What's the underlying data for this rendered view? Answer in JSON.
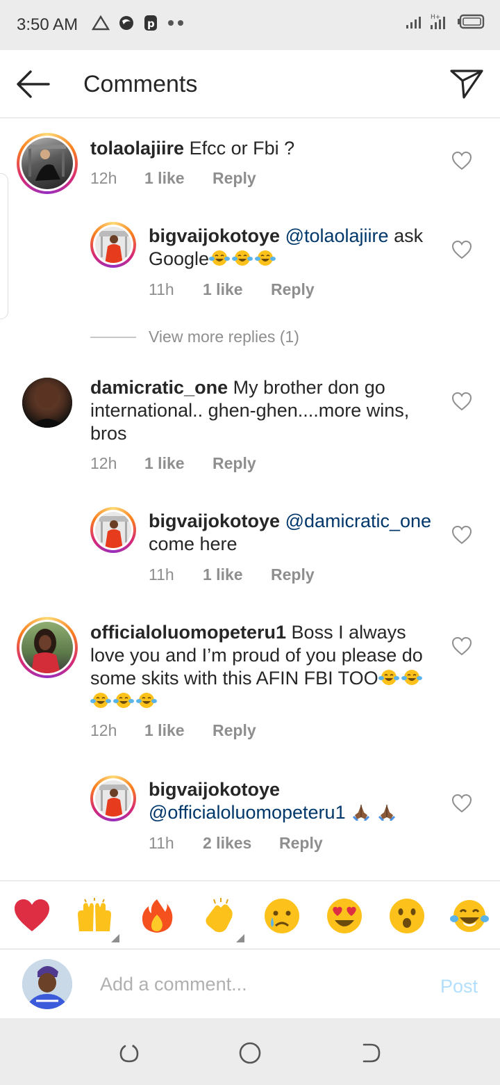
{
  "status_bar": {
    "time": "3:50 AM"
  },
  "header": {
    "title": "Comments"
  },
  "comments": [
    {
      "username": "tolaolajiire",
      "text": "Efcc or Fbi ?",
      "time": "12h",
      "likes": "1 like",
      "reply": "Reply"
    },
    {
      "username": "bigvaijokotoye",
      "mention": "@tolaolajiire",
      "text": "ask Google",
      "time": "11h",
      "likes": "1 like",
      "reply": "Reply"
    },
    {
      "username": "damicratic_one",
      "text": "My brother don go international.. ghen-ghen....more wins, bros",
      "time": "12h",
      "likes": "1 like",
      "reply": "Reply"
    },
    {
      "username": "bigvaijokotoye",
      "mention": "@damicratic_one",
      "text": "come here",
      "time": "11h",
      "likes": "1 like",
      "reply": "Reply"
    },
    {
      "username": "officialoluomopeteru1",
      "text": "Boss I always love you and I’m proud of you please do some skits with this AFIN FBI TOO",
      "time": "12h",
      "likes": "1 like",
      "reply": "Reply"
    },
    {
      "username": "bigvaijokotoye",
      "mention": "@officialoluomopeteru1",
      "text": "",
      "time": "11h",
      "likes": "2 likes",
      "reply": "Reply"
    }
  ],
  "view_more_replies": "View more replies (1)",
  "reactions": [
    "red-heart",
    "raising-hands",
    "fire",
    "clapping-hands",
    "crying-face",
    "heart-eyes",
    "surprised-face",
    "tears-of-joy"
  ],
  "input": {
    "placeholder": "Add a comment...",
    "post_label": "Post"
  },
  "colors": {
    "link": "#00376b",
    "muted": "#8e8e8e",
    "post_disabled": "#b2dffc",
    "text": "#262626"
  }
}
